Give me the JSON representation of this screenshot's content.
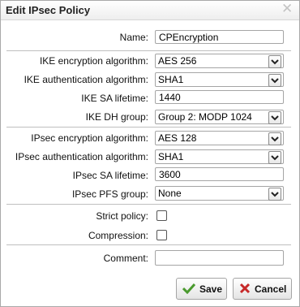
{
  "dialog": {
    "title": "Edit IPsec Policy",
    "close_glyph": "✕"
  },
  "form": {
    "name": {
      "label": "Name:",
      "value": "CPEncryption"
    },
    "ike_encryption": {
      "label": "IKE encryption algorithm:",
      "value": "AES 256"
    },
    "ike_authentication": {
      "label": "IKE authentication algorithm:",
      "value": "SHA1"
    },
    "ike_sa_lifetime": {
      "label": "IKE SA lifetime:",
      "value": "1440"
    },
    "ike_dh_group": {
      "label": "IKE DH group:",
      "value": "Group 2: MODP 1024"
    },
    "ipsec_encryption": {
      "label": "IPsec encryption algorithm:",
      "value": "AES 128"
    },
    "ipsec_authentication": {
      "label": "IPsec authentication algorithm:",
      "value": "SHA1"
    },
    "ipsec_sa_lifetime": {
      "label": "IPsec SA lifetime:",
      "value": "3600"
    },
    "ipsec_pfs_group": {
      "label": "IPsec PFS group:",
      "value": "None"
    },
    "strict_policy": {
      "label": "Strict policy:",
      "checked": false
    },
    "compression": {
      "label": "Compression:",
      "checked": false
    },
    "comment": {
      "label": "Comment:",
      "value": ""
    }
  },
  "buttons": {
    "save": {
      "label": "Save",
      "icon": "check-icon",
      "color": "#4a9a2e"
    },
    "cancel": {
      "label": "Cancel",
      "icon": "x-icon",
      "color": "#c62828"
    }
  }
}
